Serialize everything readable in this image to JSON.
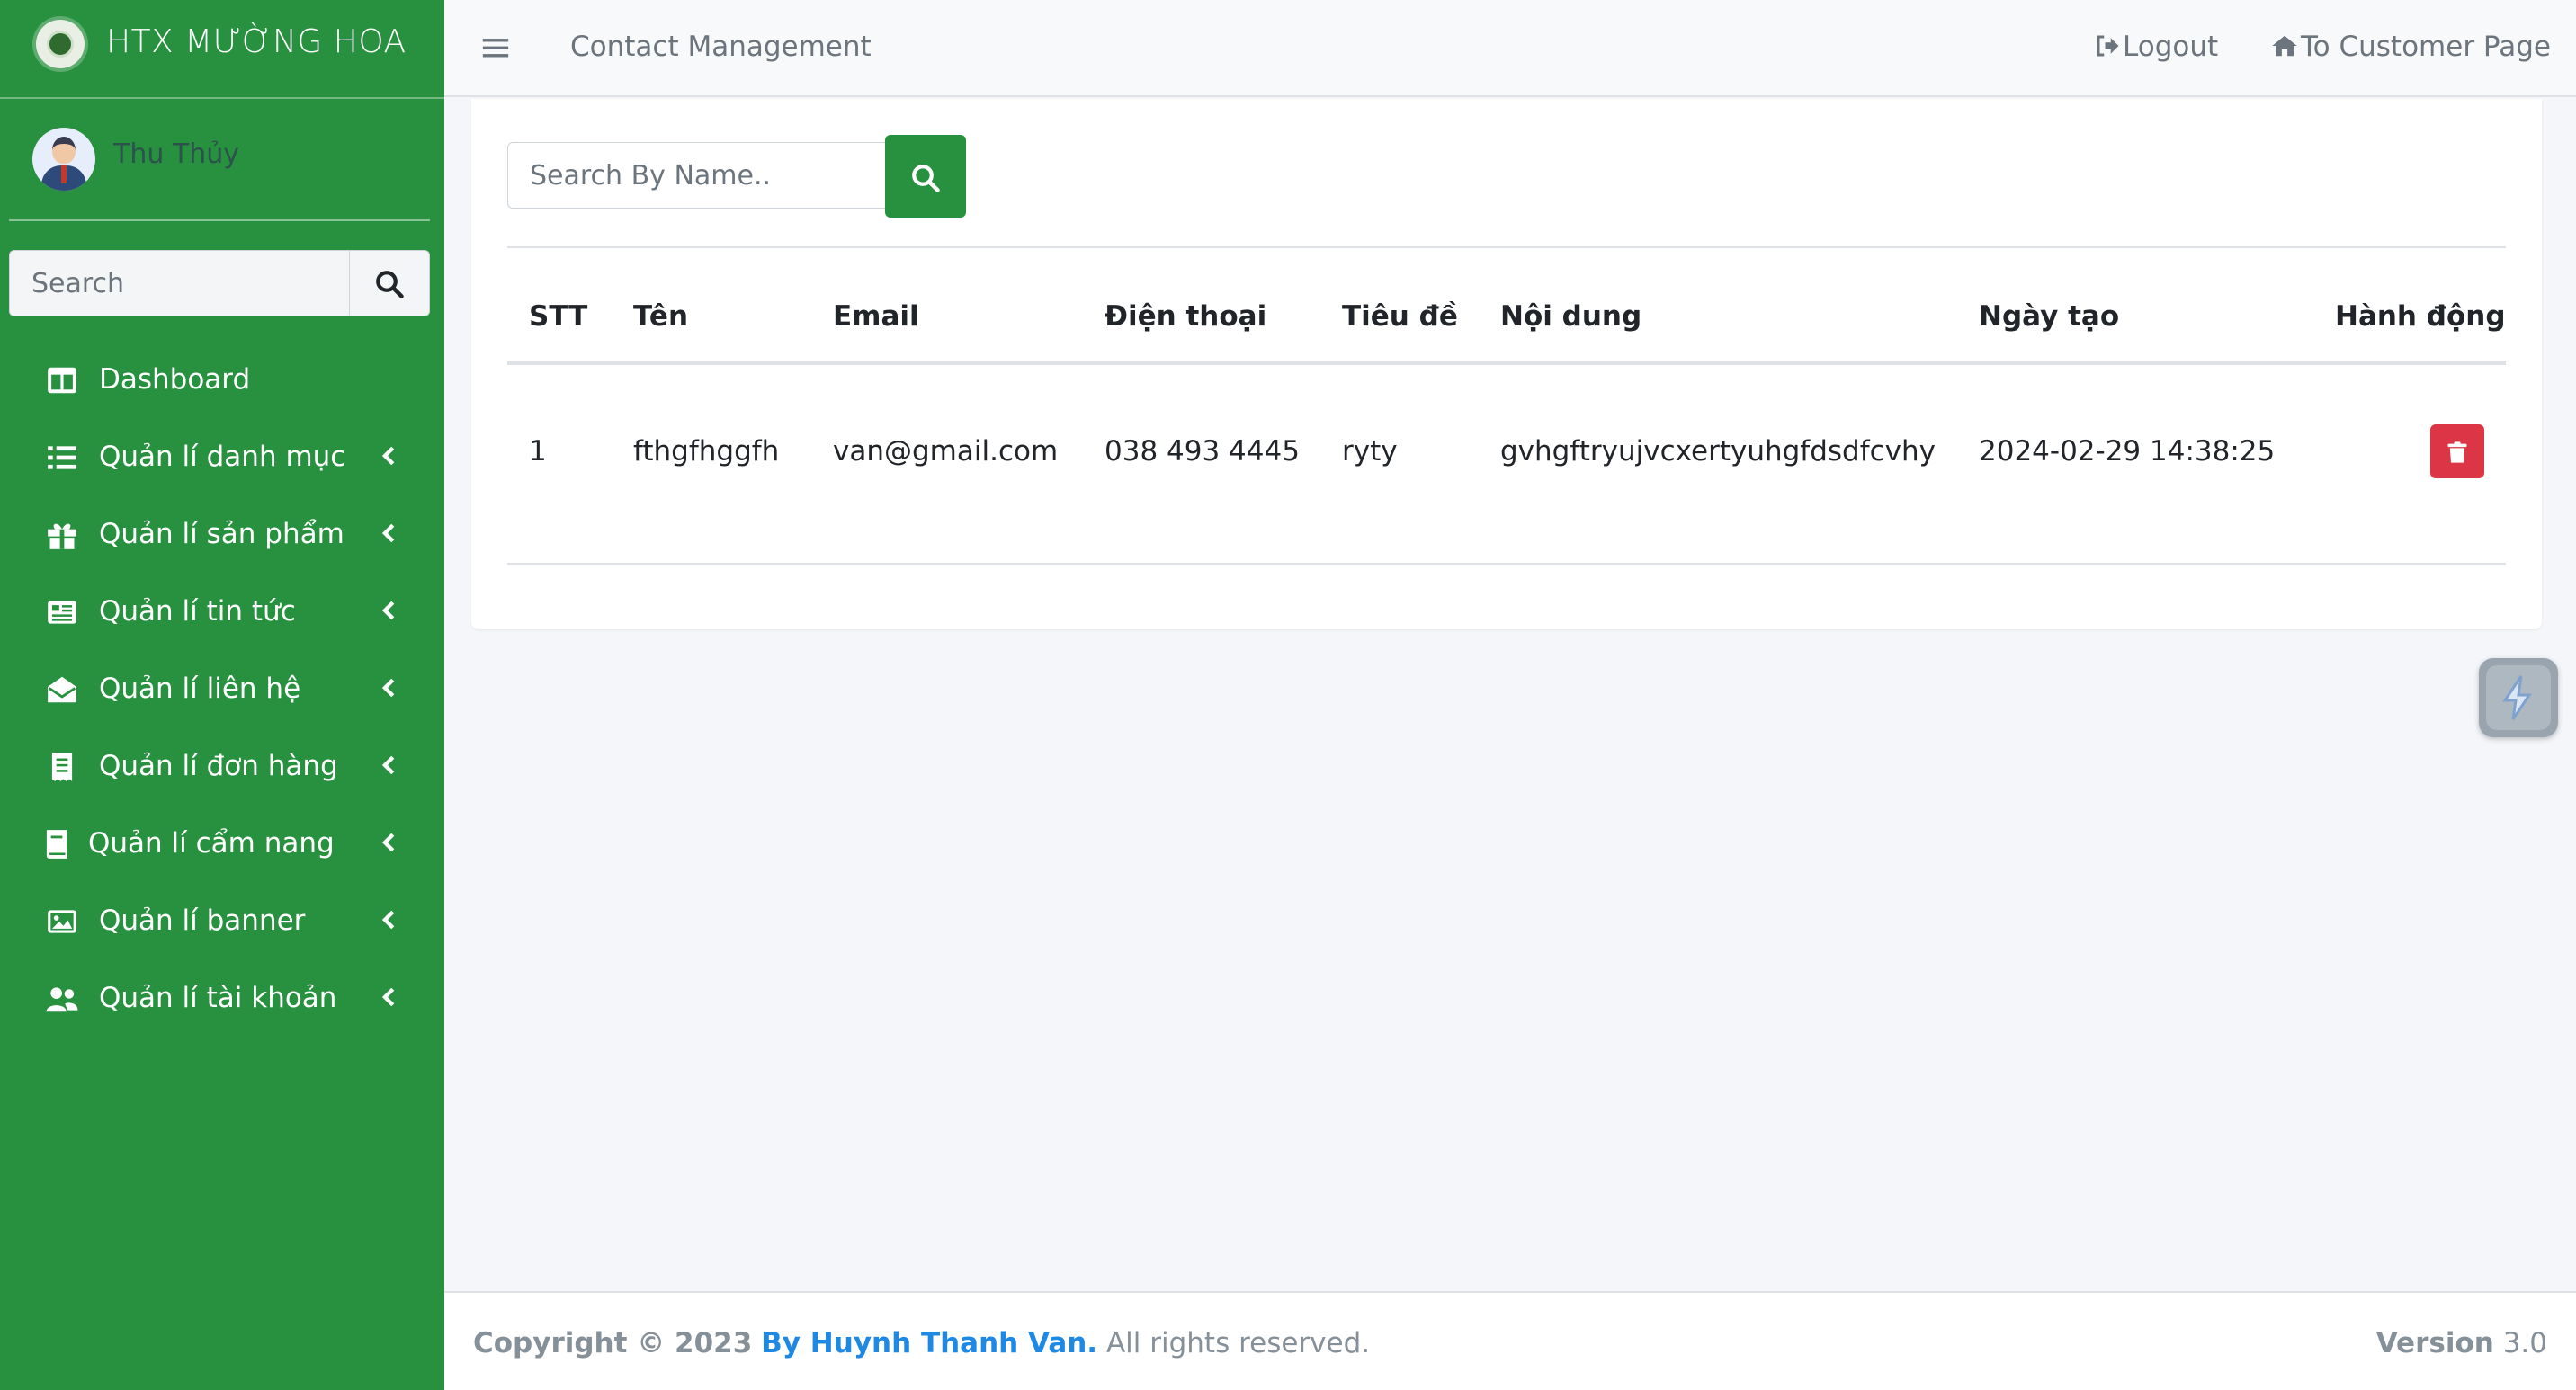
{
  "sidebar": {
    "brand": "HTX MƯỜNG HOA",
    "user_name": "Thu Thủy",
    "search_placeholder": "Search",
    "items": [
      {
        "label": "Dashboard",
        "icon": "columns-icon"
      },
      {
        "label": "Quản lí danh mục",
        "icon": "list-icon"
      },
      {
        "label": "Quản lí sản phẩm",
        "icon": "gift-icon"
      },
      {
        "label": "Quản lí tin tức",
        "icon": "newspaper-icon"
      },
      {
        "label": "Quản lí liên hệ",
        "icon": "envelope-open-icon"
      },
      {
        "label": "Quản lí đơn hàng",
        "icon": "receipt-icon"
      },
      {
        "label": "Quản lí cẩm nang",
        "icon": "book-icon"
      },
      {
        "label": "Quản lí banner",
        "icon": "image-icon"
      },
      {
        "label": "Quản lí tài khoản",
        "icon": "users-icon"
      }
    ]
  },
  "topbar": {
    "title": "Contact Management",
    "logout": "Logout",
    "customer_page": "To Customer Page"
  },
  "main": {
    "search_placeholder": "Search By Name..",
    "columns": [
      "STT",
      "Tên",
      "Email",
      "Điện thoại",
      "Tiêu đề",
      "Nội dung",
      "Ngày tạo",
      "Hành động"
    ],
    "rows": [
      {
        "stt": "1",
        "ten": "fthgfhggfh",
        "email": "van@gmail.com",
        "dien_thoai": "038 493 4445",
        "tieu_de": "ryty",
        "noi_dung": "gvhgftryujvcxertyuhgfdsdfcvhy",
        "ngay_tao": "2024-02-29 14:38:25"
      }
    ]
  },
  "footer": {
    "copyright": "Copyright © 2023",
    "author": "By Huynh Thanh Van.",
    "rights": "All rights reserved.",
    "version_label": "Version",
    "version_value": "3.0"
  },
  "colors": {
    "sidebar": "#28913f",
    "primary_button": "#28913f",
    "danger": "#dc3545",
    "link": "#1e88e5"
  }
}
